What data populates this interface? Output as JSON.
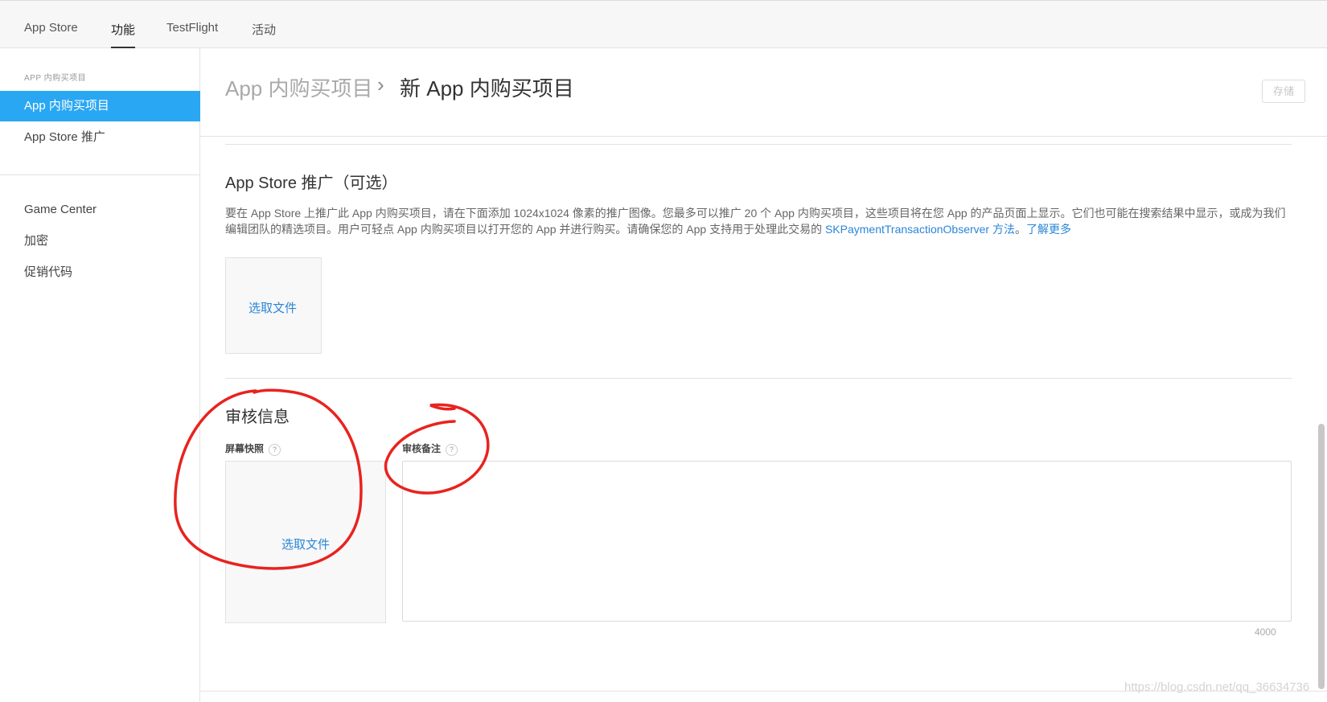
{
  "nav": {
    "tabs": [
      {
        "label": "App Store"
      },
      {
        "label": "功能"
      },
      {
        "label": "TestFlight"
      },
      {
        "label": "活动"
      }
    ],
    "active_tab": "功能"
  },
  "sidebar": {
    "section_header": "APP 内购买项目",
    "items": [
      {
        "label": "App 内购买项目"
      },
      {
        "label": "App Store 推广"
      },
      {
        "label": "Game Center"
      },
      {
        "label": "加密"
      },
      {
        "label": "促销代码"
      }
    ],
    "active_item": "App 内购买项目"
  },
  "header": {
    "breadcrumb_parent": "App 内购买项目",
    "breadcrumb_separator": "›",
    "breadcrumb_current": "新 App 内购买项目",
    "save_label": "存储"
  },
  "promotion": {
    "title": "App Store 推广（可选）",
    "description_part1": "要在 App Store 上推广此 App 内购买项目，请在下面添加 1024x1024 像素的推广图像。您最多可以推广 20 个 App 内购买项目，这些项目将在您 App 的产品页面上显示。它们也可能在搜索结果中显示，或成为我们编辑团队的精选项目。用户可轻点 App 内购买项目以打开您的 App 并进行购买。请确保您的 App 支持用于处理此交易的 ",
    "link_observer": "SKPaymentTransactionObserver 方法",
    "description_part2": "。",
    "link_learn_more": "了解更多",
    "choose_file": "选取文件"
  },
  "review": {
    "title": "审核信息",
    "screenshot_label": "屏幕快照",
    "notes_label": "审核备注",
    "help_glyph": "?",
    "choose_file": "选取文件",
    "notes_value": "",
    "notes_counter": "4000"
  },
  "watermark": "https://blog.csdn.net/qq_36634736",
  "colors": {
    "accent_blue": "#2aa7f2",
    "link_blue": "#2a86d8",
    "annotation_red": "#e8231f"
  }
}
